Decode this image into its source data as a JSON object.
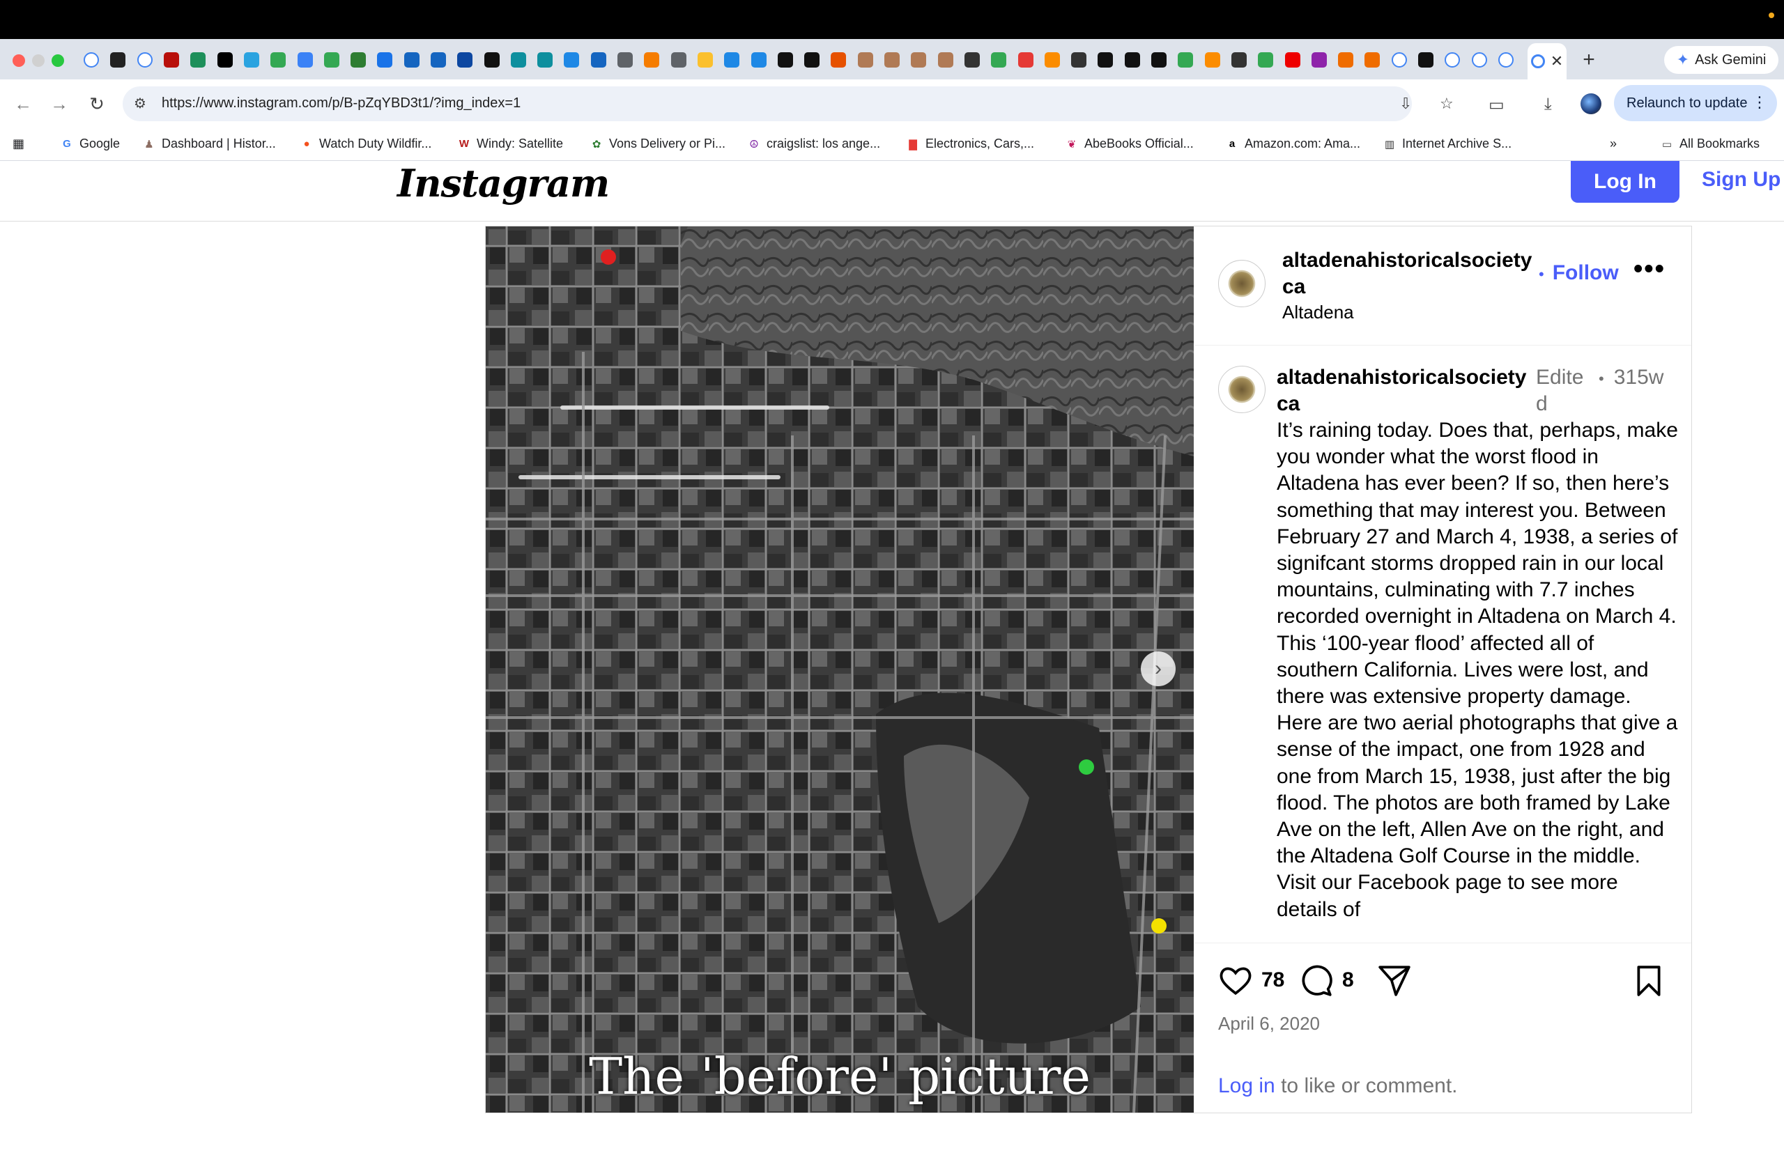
{
  "browser": {
    "url": "https://www.instagram.com/p/B-pZqYBD3t1/?img_index=1",
    "gemini_label": "Ask Gemini",
    "relaunch_label": "Relaunch to update",
    "tab_count": 54,
    "bookmarks": [
      {
        "label": "Google",
        "icon": "google-icon"
      },
      {
        "label": "Dashboard | Histor...",
        "icon": "ancestry-icon"
      },
      {
        "label": "Watch Duty Wildfir...",
        "icon": "fire-icon"
      },
      {
        "label": "Windy: Satellite",
        "icon": "windy-icon"
      },
      {
        "label": "Vons Delivery or Pi...",
        "icon": "vons-icon"
      },
      {
        "label": "craigslist: los ange...",
        "icon": "peace-icon"
      },
      {
        "label": "Electronics, Cars,...",
        "icon": "ebay-icon"
      },
      {
        "label": "AbeBooks Official...",
        "icon": "abebooks-icon"
      },
      {
        "label": "Amazon.com: Ama...",
        "icon": "amazon-icon"
      },
      {
        "label": "Internet Archive S...",
        "icon": "archive-icon"
      }
    ],
    "all_bookmarks_label": "All Bookmarks"
  },
  "instagram": {
    "logo": "Instagram",
    "login_label": "Log In",
    "signup_label": "Sign Up",
    "post": {
      "image_caption": "The 'before' picture",
      "author": "altadenahistoricalsocietyca",
      "follow_label": "Follow",
      "location": "Altadena",
      "edited_label": "Edited",
      "age": "315w",
      "caption": "It’s raining today.  Does that, perhaps, make you wonder what the worst flood in Altadena has ever been?  If so, then here’s something that may interest you. Between February 27 and March 4, 1938, a series of signifcant storms dropped rain in our local mountains, culminating with 7.7 inches recorded overnight in Altadena on March 4.  This ‘100-year flood’ affected all of southern California.  Lives were lost, and there was extensive property damage.\nHere are two aerial photographs that give a sense of the impact, one from 1928 and one from March 15, 1938, just after the big flood.  The photos are both framed by Lake Ave on the left, Allen Ave on the right, and the Altadena Golf Course in the middle.  Visit our Facebook page to see more details of",
      "likes": "78",
      "comments": "8",
      "date": "April 6, 2020",
      "login_link": "Log in",
      "login_suffix": " to like or comment."
    }
  }
}
